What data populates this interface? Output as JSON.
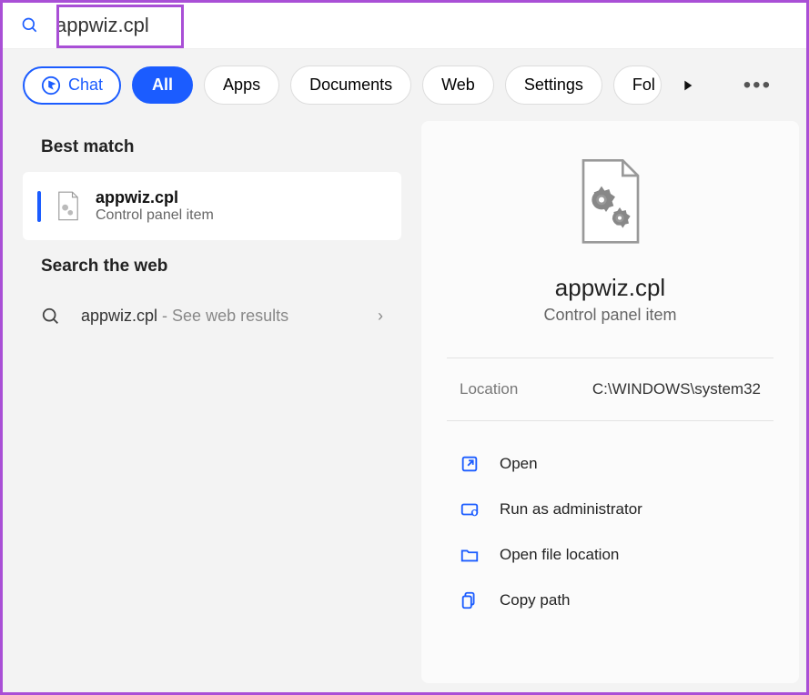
{
  "search": {
    "value": "appwiz.cpl",
    "placeholder": ""
  },
  "filters": {
    "chat": "Chat",
    "all": "All",
    "apps": "Apps",
    "documents": "Documents",
    "web": "Web",
    "settings": "Settings",
    "folders_cut": "Fol"
  },
  "sections": {
    "best_match": "Best match",
    "search_web": "Search the web"
  },
  "best_match_result": {
    "title": "appwiz.cpl",
    "subtitle": "Control panel item"
  },
  "web_result": {
    "prefix": "appwiz.cpl",
    "suffix": " - See web results"
  },
  "preview": {
    "title": "appwiz.cpl",
    "subtitle": "Control panel item",
    "location_label": "Location",
    "location_value": "C:\\WINDOWS\\system32"
  },
  "actions": {
    "open": "Open",
    "run_admin": "Run as administrator",
    "open_location": "Open file location",
    "copy_path": "Copy path"
  }
}
